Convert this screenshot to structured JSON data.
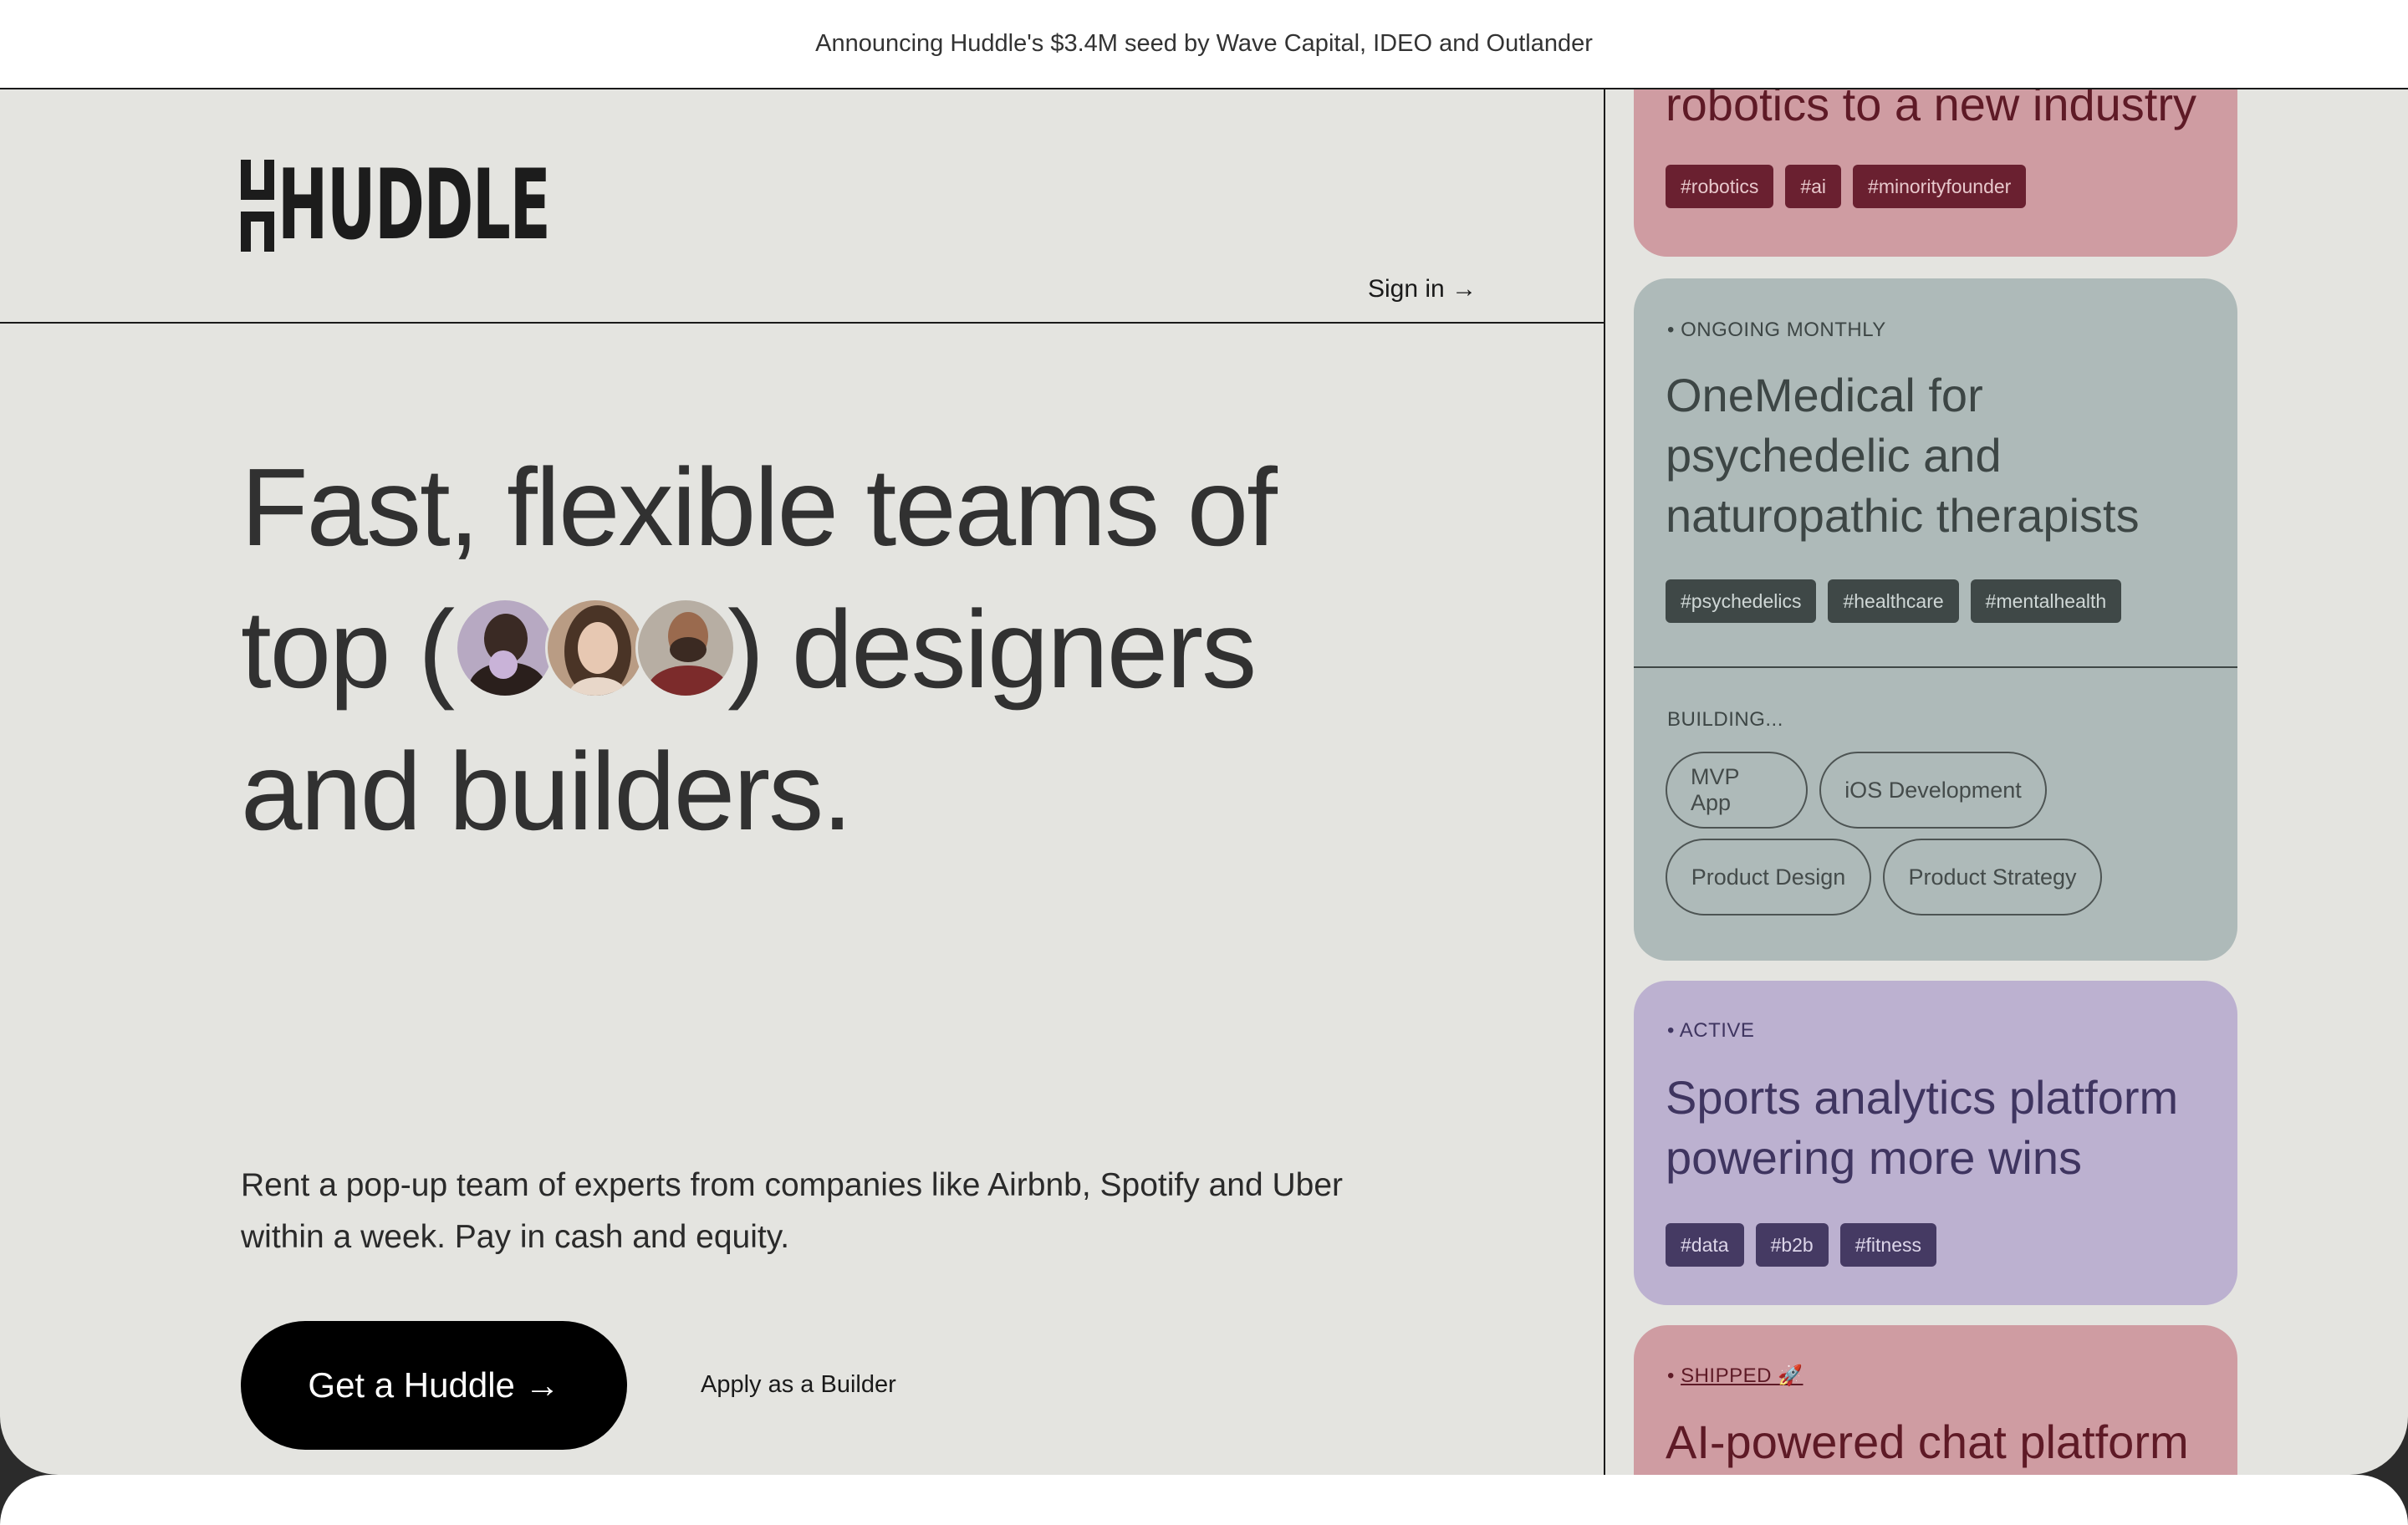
{
  "announcement": "Announcing Huddle's $3.4M seed by Wave Capital, IDEO and Outlander",
  "logo": "HUDDLE",
  "nav": {
    "signin": "Sign in →"
  },
  "hero": {
    "line1": "Fast, flexible teams of",
    "line2_pre": "top (",
    "line2_post": ") designers",
    "line3": "and builders."
  },
  "subtitle": "Rent a pop-up team of experts from companies like Airbnb, Spotify and Uber within a week. Pay in cash and equity.",
  "cta": {
    "primary": "Get a Huddle →",
    "secondary": "Apply as a Builder"
  },
  "cards": [
    {
      "title": "robotics to a new industry",
      "tags": [
        "#robotics",
        "#ai",
        "#minorityfounder"
      ],
      "bg": "#cf9ca2",
      "fg": "#5e1a26",
      "tag_bg": "#6a2030",
      "tag_fg": "#e8c8cc"
    },
    {
      "status": "• ONGOING MONTHLY",
      "title": "OneMedical for psychedelic and naturopathic therapists",
      "tags": [
        "#psychedelics",
        "#healthcare",
        "#mentalhealth"
      ],
      "building_label": "BUILDING...",
      "building": [
        "MVP App",
        "iOS Development",
        "Product Design",
        "Product Strategy"
      ],
      "bg": "#aebab9",
      "fg": "#3d4645",
      "tag_bg": "#3f4847",
      "tag_fg": "#cfd7d6"
    },
    {
      "status": "• ACTIVE",
      "title": "Sports analytics platform powering more wins",
      "tags": [
        "#data",
        "#b2b",
        "#fitness"
      ],
      "bg": "#bcb1d0",
      "fg": "#3f3560",
      "tag_bg": "#453a63",
      "tag_fg": "#ddd6ea"
    },
    {
      "status_prefix": "• ",
      "status": "SHIPPED 🚀",
      "title": "AI-powered chat platform",
      "bg": "#cf9ca2",
      "fg": "#5e1a26"
    }
  ]
}
